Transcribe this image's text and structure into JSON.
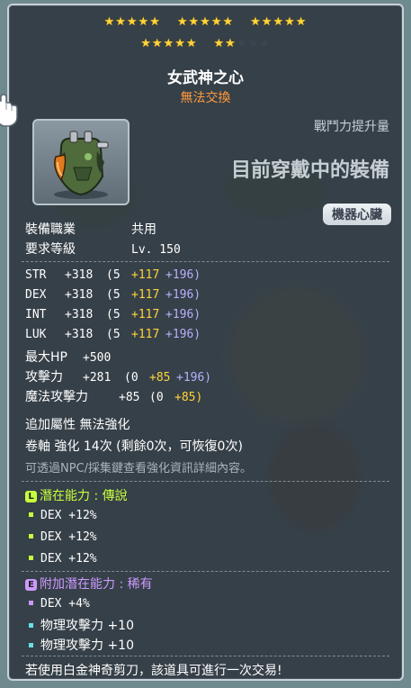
{
  "colors": {
    "legendary": "#c8ff3c",
    "rare": "#cc99ff",
    "star_on": "#ffd43a",
    "untradeable": "#ff9a3c"
  },
  "stars": {
    "total": 25,
    "filled": 22
  },
  "item": {
    "name": "女武神之心",
    "trade_status": "無法交換",
    "attack_increase_label": "戰鬥力提升量",
    "equipped_label": "目前穿戴中的裝備",
    "category": "機器心臟",
    "icon": "mechanical-heart-icon"
  },
  "requirements": [
    {
      "label": "裝備職業",
      "value": "共用"
    },
    {
      "label": "要求等級",
      "value": "Lv. 150"
    }
  ],
  "stats": [
    {
      "name": "STR",
      "total": "+318",
      "base": "(5",
      "bonus": "+117",
      "star": "+196)"
    },
    {
      "name": "DEX",
      "total": "+318",
      "base": "(5",
      "bonus": "+117",
      "star": "+196)"
    },
    {
      "name": "INT",
      "total": "+318",
      "base": "(5",
      "bonus": "+117",
      "star": "+196)"
    },
    {
      "name": "LUK",
      "total": "+318",
      "base": "(5",
      "bonus": "+117",
      "star": "+196)"
    },
    {
      "name": "最大HP",
      "total": "+500",
      "base": "",
      "bonus": "",
      "star": ""
    },
    {
      "name": "攻擊力",
      "total": "+281",
      "base": "(0",
      "bonus": "+85",
      "star": "+196)"
    },
    {
      "name": "魔法攻擊力",
      "total": "+85",
      "base": "(0",
      "bonus": "+85)",
      "star": ""
    }
  ],
  "extra": {
    "attribute": "追加屬性 無法強化",
    "scroll": "卷軸 強化 14次 (剩餘0次，可恢復0次)",
    "hint": "可透過NPC/採集鍵查看強化資訊詳細內容。"
  },
  "potential": {
    "badge": "L",
    "title": "潛在能力 : 傳說",
    "lines": [
      "DEX +12%",
      "DEX +12%",
      "DEX +12%"
    ]
  },
  "additional_potential": {
    "badge": "E",
    "title": "附加潛在能力 : 稀有",
    "lines": [
      "DEX +4%",
      "物理攻擊力 +10",
      "物理攻擊力 +10"
    ]
  },
  "footer": "若使用白金神奇剪刀，該道具可進行一次交易!"
}
